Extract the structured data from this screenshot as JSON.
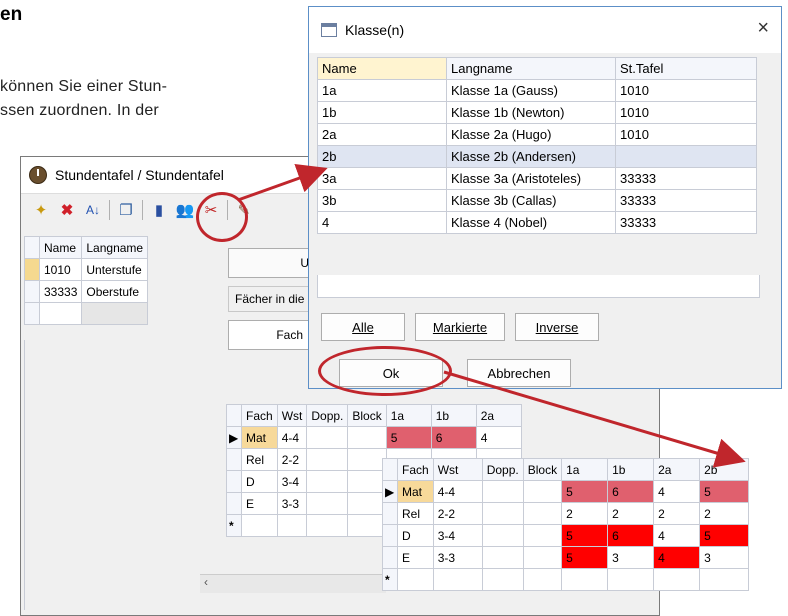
{
  "doc": {
    "heading_fragment": "en",
    "line1_fragment": "können Sie einer Stun-",
    "line2_fragment": "ssen zuordnen. In der"
  },
  "main_window": {
    "title": "Stundentafel / Stundentafel",
    "lehrplan_columns": [
      "Name",
      "Langname"
    ],
    "lehrplan_rows": [
      {
        "name": "1010",
        "langname": "Unterstufe"
      },
      {
        "name": "33333",
        "langname": "Oberstufe"
      }
    ],
    "tab_fragment": "U",
    "faecher_label_fragment": "Fächer in die",
    "fach_button_fragment": "Fach"
  },
  "grid_columns_small": [
    "Fach",
    "Wst",
    "Dopp.",
    "Block",
    "1a",
    "1b",
    "2a"
  ],
  "grid_rows_small": [
    {
      "fach": "Mat",
      "wst": "4-4",
      "c1a": "5",
      "c1b": "6",
      "c2a": "4"
    },
    {
      "fach": "Rel",
      "wst": "2-2"
    },
    {
      "fach": "D",
      "wst": "3-4"
    },
    {
      "fach": "E",
      "wst": "3-3"
    }
  ],
  "dialog": {
    "title": "Klasse(n)",
    "close_glyph": "×",
    "columns": [
      "Name",
      "Langname",
      "St.Tafel"
    ],
    "rows": [
      {
        "name": "1a",
        "langname": "Klasse 1a (Gauss)",
        "tafel": "1010"
      },
      {
        "name": "1b",
        "langname": "Klasse 1b (Newton)",
        "tafel": "1010"
      },
      {
        "name": "2a",
        "langname": "Klasse 2a (Hugo)",
        "tafel": "1010"
      },
      {
        "name": "2b",
        "langname": "Klasse 2b (Andersen)",
        "tafel": ""
      },
      {
        "name": "3a",
        "langname": "Klasse 3a (Aristoteles)",
        "tafel": "33333"
      },
      {
        "name": "3b",
        "langname": "Klasse 3b (Callas)",
        "tafel": "33333"
      },
      {
        "name": "4",
        "langname": "Klasse 4 (Nobel)",
        "tafel": "33333"
      }
    ],
    "btn_alle": "Alle",
    "btn_markierte": "Markierte",
    "btn_inverse": "Inverse",
    "btn_ok": "Ok",
    "btn_abbrechen": "Abbrechen"
  },
  "grid_columns_big": [
    "Fach",
    "Wst",
    "Dopp.",
    "Block",
    "1a",
    "1b",
    "2a",
    "2b"
  ],
  "grid_rows_big": [
    {
      "fach": "Mat",
      "wst": "4-4",
      "c1a": "5",
      "c1b": "6",
      "c2a": "4",
      "c2b": "5"
    },
    {
      "fach": "Rel",
      "wst": "2-2",
      "c1a": "2",
      "c1b": "2",
      "c2a": "2",
      "c2b": "2"
    },
    {
      "fach": "D",
      "wst": "3-4",
      "c1a": "5",
      "c1b": "6",
      "c2a": "4",
      "c2b": "5"
    },
    {
      "fach": "E",
      "wst": "3-3",
      "c1a": "5",
      "c1b": "3",
      "c2a": "4",
      "c2b": "3"
    }
  ],
  "new_row_marker": "*",
  "colors": {
    "pink": "#e0606e",
    "red": "#ff0000",
    "highlight": "#c0262c",
    "selected": "#f7d99a"
  }
}
